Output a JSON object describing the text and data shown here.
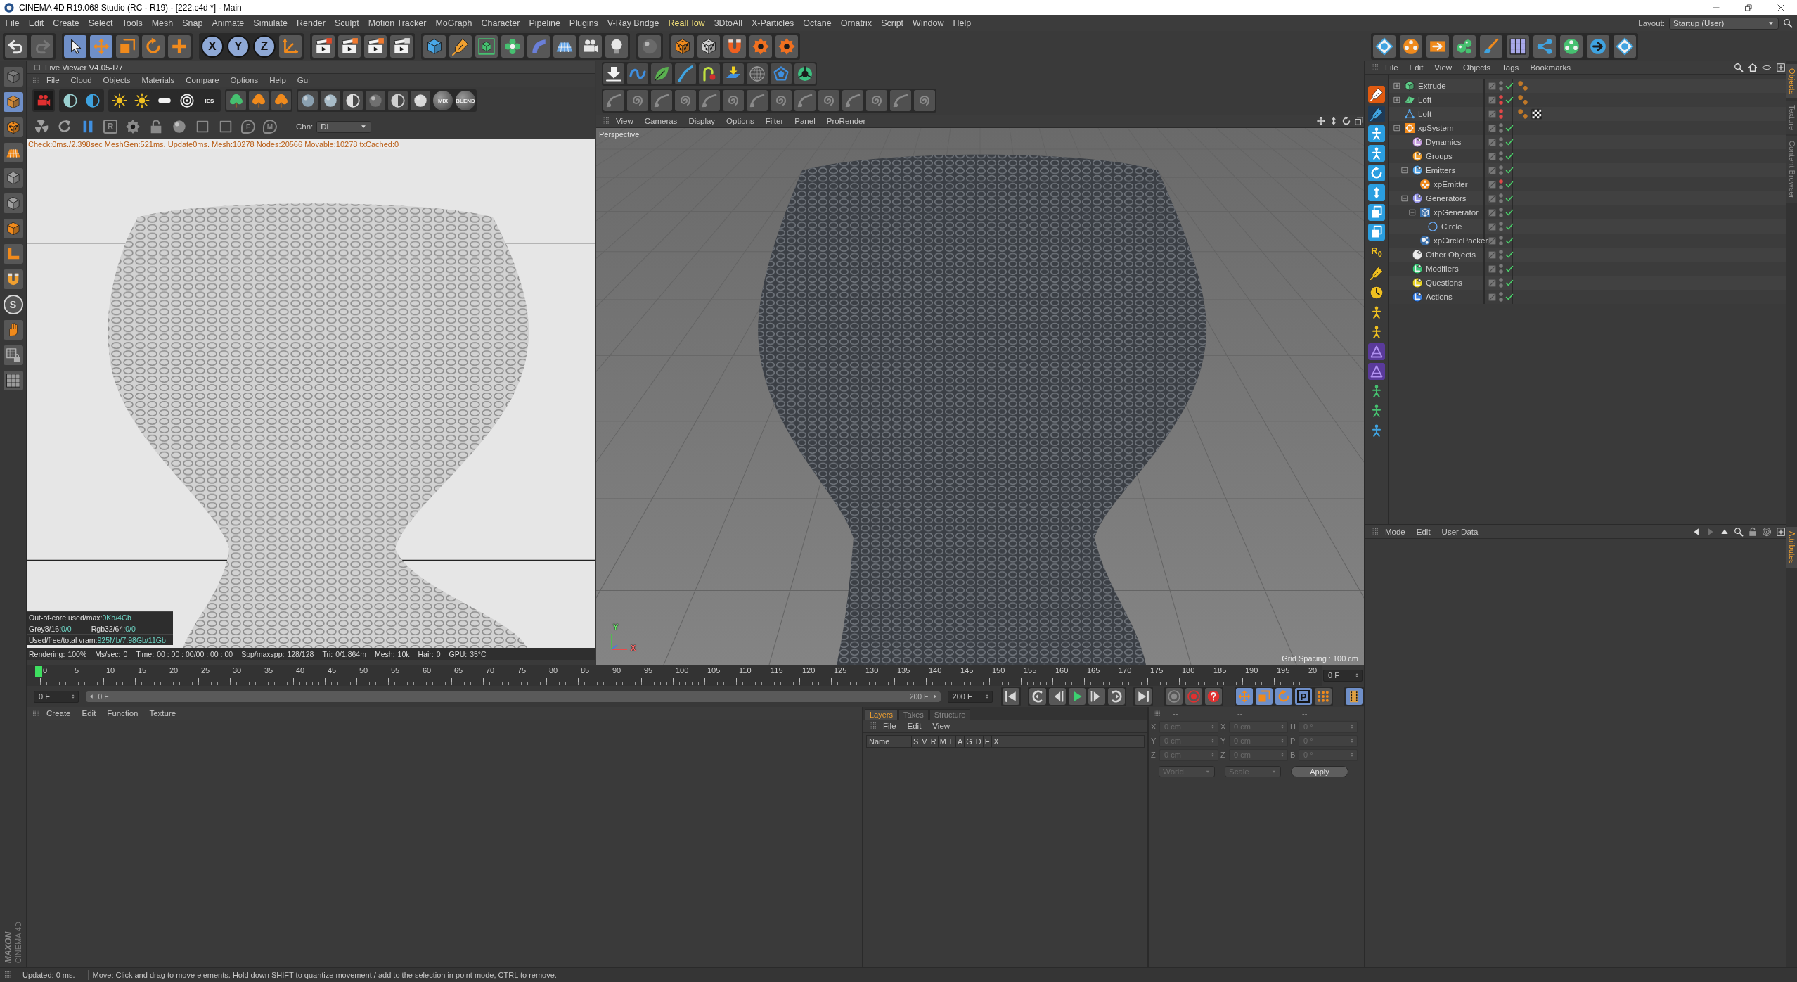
{
  "title_bar": {
    "title": "CINEMA 4D R19.068 Studio (RC - R19) - [222.c4d *] - Main"
  },
  "menu_bar": {
    "items": [
      {
        "label": "File",
        "highlighted": false
      },
      {
        "label": "Edit",
        "highlighted": false
      },
      {
        "label": "Create",
        "highlighted": false
      },
      {
        "label": "Select",
        "highlighted": false
      },
      {
        "label": "Tools",
        "highlighted": false
      },
      {
        "label": "Mesh",
        "highlighted": false
      },
      {
        "label": "Snap",
        "highlighted": false
      },
      {
        "label": "Animate",
        "highlighted": false
      },
      {
        "label": "Simulate",
        "highlighted": false
      },
      {
        "label": "Render",
        "highlighted": false
      },
      {
        "label": "Sculpt",
        "highlighted": false
      },
      {
        "label": "Motion Tracker",
        "highlighted": false
      },
      {
        "label": "MoGraph",
        "highlighted": false
      },
      {
        "label": "Character",
        "highlighted": false
      },
      {
        "label": "Pipeline",
        "highlighted": false
      },
      {
        "label": "Plugins",
        "highlighted": false
      },
      {
        "label": "V-Ray Bridge",
        "highlighted": false
      },
      {
        "label": "RealFlow",
        "highlighted": true
      },
      {
        "label": "3DtoAll",
        "highlighted": false
      },
      {
        "label": "X-Particles",
        "highlighted": false
      },
      {
        "label": "Octane",
        "highlighted": false
      },
      {
        "label": "Ornatrix",
        "highlighted": false
      },
      {
        "label": "Script",
        "highlighted": false
      },
      {
        "label": "Window",
        "highlighted": false
      },
      {
        "label": "Help",
        "highlighted": false
      }
    ],
    "layout_label": "Layout:",
    "layout_value": "Startup (User)"
  },
  "main_toolbar": {
    "tools": [
      {
        "selected": true
      },
      {
        "selected": true
      },
      {
        "selected": false
      },
      {
        "selected": false
      },
      {
        "selected": false
      }
    ],
    "axes": [
      {
        "label": "X",
        "selected": true
      },
      {
        "label": "Y",
        "selected": true
      },
      {
        "label": "Z",
        "selected": true
      }
    ]
  },
  "left_toolbar": {
    "snap_label": "S"
  },
  "live_viewer": {
    "title": "Live Viewer V4.05-R7",
    "menu": [
      "File",
      "Cloud",
      "Objects",
      "Materials",
      "Compare",
      "Options",
      "Help",
      "Gui"
    ],
    "light_label": "IES",
    "material_labels": [
      "MIX",
      "BLEND"
    ],
    "region_label": "R",
    "pin_labels": [
      "F",
      "M"
    ],
    "channel_label": "Chn:",
    "channel_value": "DL",
    "status": "Check:0ms./2.398sec MeshGen:521ms. Update0ms. Mesh:10278 Nodes:20566 Movable:10278 txCached:0",
    "memory_stats": [
      [
        {
          "label": "Out-of-core used/max:",
          "value": "0Kb/4Gb"
        }
      ],
      [
        {
          "label": "Grey8/16:",
          "value": "0/0"
        },
        {
          "label": "Rgb32/64:",
          "value": "0/0"
        }
      ],
      [
        {
          "label": "Used/free/total vram:",
          "value": "925Mb/7.98Gb/11Gb"
        }
      ]
    ],
    "render_stats": [
      {
        "label": "Rendering:",
        "value": "100%"
      },
      {
        "label": "Ms/sec:",
        "value": "0"
      },
      {
        "label": "Time:",
        "value": "00 : 00 : 00/00 : 00 : 00"
      },
      {
        "label": "Spp/maxspp:",
        "value": "128/128"
      },
      {
        "label": "Tri:",
        "value": "0/1.864m"
      },
      {
        "label": "Mesh:",
        "value": "10k"
      },
      {
        "label": "Hair:",
        "value": "0"
      },
      {
        "label": "GPU:",
        "value": "35°C"
      }
    ]
  },
  "viewport": {
    "menu": [
      "View",
      "Cameras",
      "Display",
      "Options",
      "Filter",
      "Panel",
      "ProRender"
    ],
    "camera": "Perspective",
    "grid_spacing": "Grid Spacing : 100 cm",
    "axis_labels": [
      "Y",
      "X"
    ]
  },
  "timeline": {
    "ticks": [
      "0",
      "5",
      "10",
      "15",
      "20",
      "25",
      "30",
      "35",
      "40",
      "45",
      "50",
      "55",
      "60",
      "65",
      "70",
      "75",
      "80",
      "85",
      "90",
      "95",
      "100",
      "105",
      "110",
      "115",
      "120",
      "125",
      "130",
      "135",
      "140",
      "145",
      "150",
      "155",
      "160",
      "165",
      "170",
      "175",
      "180",
      "185",
      "190",
      "195",
      "20"
    ],
    "playhead": {
      "level": 0
    },
    "ruler_field": "0 F",
    "start_field": "0 F",
    "range_start": "0 F",
    "range_end": "200 F",
    "range_fill": {
      "level": 1
    },
    "end_field": "200 F",
    "record_channels": [
      {
        "kind": "move",
        "selected": true
      },
      {
        "kind": "scale",
        "selected": true
      },
      {
        "kind": "rotate",
        "selected": true
      },
      {
        "kind": "param",
        "label": "P",
        "selected": true
      },
      {
        "kind": "points",
        "selected": false
      }
    ]
  },
  "material_manager": {
    "menu": [
      "Create",
      "Edit",
      "Function",
      "Texture"
    ]
  },
  "layers": {
    "tabs": [
      {
        "label": "Layers",
        "selected": true
      },
      {
        "label": "Takes",
        "selected": false
      },
      {
        "label": "Structure",
        "selected": false
      }
    ],
    "menu": [
      "File",
      "Edit",
      "View"
    ],
    "columns": [
      "Name",
      "S",
      "V",
      "R",
      "M",
      "L",
      "A",
      "G",
      "D",
      "E",
      "X"
    ]
  },
  "coordinates": {
    "headers": [
      "--",
      "--",
      "--"
    ],
    "disabled": true,
    "rows": [
      {
        "axis": "X",
        "position": "0 cm",
        "size_axis": "X",
        "size": "0 cm",
        "rotation_axis": "H",
        "rotation": "0 °"
      },
      {
        "axis": "Y",
        "position": "0 cm",
        "size_axis": "Y",
        "size": "0 cm",
        "rotation_axis": "P",
        "rotation": "0 °"
      },
      {
        "axis": "Z",
        "position": "0 cm",
        "size_axis": "Z",
        "size": "0 cm",
        "rotation_axis": "B",
        "rotation": "0 °"
      }
    ],
    "coordinate_mode": "World",
    "size_mode": "Scale",
    "apply": "Apply"
  },
  "object_manager": {
    "menu": [
      "File",
      "Edit",
      "View",
      "Objects",
      "Tags",
      "Bookmarks"
    ],
    "strip_label": "R$_{0}$",
    "objects": [
      {
        "name": "Extrude",
        "kind": "extrude",
        "expanded": false,
        "editor_hidden": false,
        "render_hidden": false,
        "enabled": true,
        "tags": [
          {
            "kind": "dots"
          }
        ]
      },
      {
        "name": "Loft",
        "kind": "loft",
        "expanded": false,
        "editor_hidden": true,
        "render_hidden": true,
        "enabled": true,
        "tags": [
          {
            "kind": "dots"
          }
        ]
      },
      {
        "name": "Loft",
        "kind": "figure",
        "editor_hidden": true,
        "render_hidden": true,
        "tags": [
          {
            "kind": "dots"
          },
          {
            "kind": "checker"
          }
        ]
      },
      {
        "name": "xpSystem",
        "kind": "system",
        "expanded": true,
        "editor_hidden": false,
        "render_hidden": false,
        "enabled": true,
        "children": [
          {
            "name": "Dynamics",
            "kind": "group",
            "color": "#c8a0e0",
            "editor_hidden": false,
            "render_hidden": false,
            "enabled": true
          },
          {
            "name": "Groups",
            "kind": "group",
            "color": "#f0a030",
            "editor_hidden": false,
            "render_hidden": false,
            "enabled": true
          },
          {
            "name": "Emitters",
            "kind": "group",
            "color": "#5aa8e8",
            "expanded": true,
            "editor_hidden": false,
            "render_hidden": false,
            "enabled": true,
            "children": [
              {
                "name": "xpEmitter",
                "kind": "emitter",
                "editor_hidden": true,
                "render_hidden": false,
                "enabled": true
              }
            ]
          },
          {
            "name": "Generators",
            "kind": "group",
            "color": "#9494e8",
            "expanded": true,
            "editor_hidden": false,
            "render_hidden": false,
            "enabled": true,
            "children": [
              {
                "name": "xpGenerator",
                "kind": "generator",
                "expanded": true,
                "editor_hidden": false,
                "render_hidden": false,
                "enabled": true,
                "children": [
                  {
                    "name": "Circle",
                    "kind": "circle",
                    "editor_hidden": false,
                    "render_hidden": false,
                    "enabled": true
                  }
                ]
              },
              {
                "name": "xpCirclePacker",
                "kind": "packer",
                "editor_hidden": false,
                "render_hidden": false,
                "enabled": true
              }
            ]
          },
          {
            "name": "Other Objects",
            "kind": "group",
            "color": "#e6e6e6",
            "editor_hidden": false,
            "render_hidden": false,
            "enabled": true
          },
          {
            "name": "Modifiers",
            "kind": "group",
            "color": "#3cc878",
            "editor_hidden": false,
            "render_hidden": false,
            "enabled": true
          },
          {
            "name": "Questions",
            "kind": "group",
            "color": "#e8d428",
            "editor_hidden": false,
            "render_hidden": false,
            "enabled": true
          },
          {
            "name": "Actions",
            "kind": "group",
            "color": "#3c82e6",
            "editor_hidden": false,
            "render_hidden": false,
            "enabled": true
          }
        ]
      }
    ]
  },
  "attribute_manager": {
    "menu": [
      "Mode",
      "Edit",
      "User Data"
    ]
  },
  "side_tabs": {
    "top": [
      {
        "label": "Objects",
        "selected": true
      },
      {
        "label": "Texture",
        "selected": false
      },
      {
        "label": "Content Browser",
        "selected": false
      }
    ],
    "bottom": [
      {
        "label": "Attributes",
        "selected": true
      }
    ]
  },
  "brand": {
    "name": "MAXON",
    "product": "CINEMA 4D"
  },
  "status_bar": {
    "left": "Updated: 0 ms.",
    "message": "Move: Click and drag to move elements. Hold down SHIFT to quantize movement / add to the selection in point mode, CTRL to remove."
  }
}
